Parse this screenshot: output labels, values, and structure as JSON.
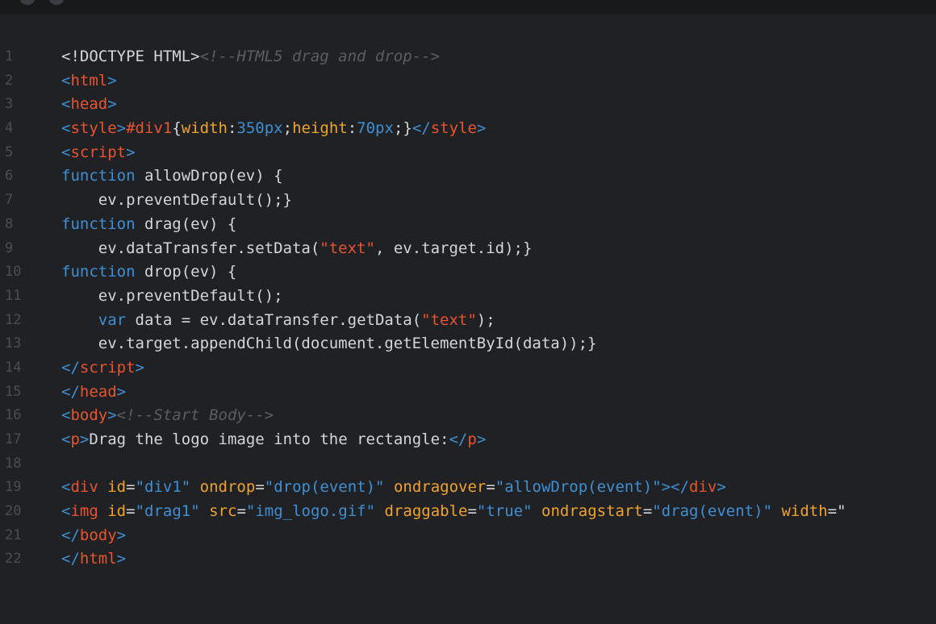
{
  "window": {
    "controls": [
      "close",
      "minimize"
    ]
  },
  "editor": {
    "line_numbers": [
      "1",
      "2",
      "3",
      "4",
      "5",
      "6",
      "7",
      "8",
      "9",
      "10",
      "11",
      "12",
      "13",
      "14",
      "15",
      "16",
      "17",
      "18",
      "19",
      "20",
      "21",
      "22"
    ],
    "lines": [
      [
        {
          "t": "<!DOCTYPE HTML>",
          "c": "plain"
        },
        {
          "t": "<!--HTML5 drag and drop-->",
          "c": "comment"
        }
      ],
      [
        {
          "t": "<",
          "c": "tag"
        },
        {
          "t": "html",
          "c": "tagname"
        },
        {
          "t": ">",
          "c": "tag"
        }
      ],
      [
        {
          "t": "<",
          "c": "tag"
        },
        {
          "t": "head",
          "c": "tagname"
        },
        {
          "t": ">",
          "c": "tag"
        }
      ],
      [
        {
          "t": "<",
          "c": "tag"
        },
        {
          "t": "style",
          "c": "tagname"
        },
        {
          "t": ">",
          "c": "tag"
        },
        {
          "t": "#div1",
          "c": "selector"
        },
        {
          "t": "{",
          "c": "punct"
        },
        {
          "t": "width",
          "c": "attr"
        },
        {
          "t": ":",
          "c": "punct"
        },
        {
          "t": "350px",
          "c": "num"
        },
        {
          "t": ";",
          "c": "punct"
        },
        {
          "t": "height",
          "c": "attr"
        },
        {
          "t": ":",
          "c": "punct"
        },
        {
          "t": "70px",
          "c": "num"
        },
        {
          "t": ";}",
          "c": "punct"
        },
        {
          "t": "</",
          "c": "tag"
        },
        {
          "t": "style",
          "c": "tagname"
        },
        {
          "t": ">",
          "c": "tag"
        }
      ],
      [
        {
          "t": "<",
          "c": "tag"
        },
        {
          "t": "script",
          "c": "tagname"
        },
        {
          "t": ">",
          "c": "tag"
        }
      ],
      [
        {
          "t": "function",
          "c": "kw"
        },
        {
          "t": " allowDrop(ev) {",
          "c": "plain"
        }
      ],
      [
        {
          "t": "    ev.preventDefault();}",
          "c": "plain"
        }
      ],
      [
        {
          "t": "function",
          "c": "kw"
        },
        {
          "t": " drag(ev) {",
          "c": "plain"
        }
      ],
      [
        {
          "t": "    ev.dataTransfer.setData(",
          "c": "plain"
        },
        {
          "t": "\"text\"",
          "c": "jsstr"
        },
        {
          "t": ", ev.target.id);}",
          "c": "plain"
        }
      ],
      [
        {
          "t": "function",
          "c": "kw"
        },
        {
          "t": " drop(ev) {",
          "c": "plain"
        }
      ],
      [
        {
          "t": "    ev.preventDefault();",
          "c": "plain"
        }
      ],
      [
        {
          "t": "    ",
          "c": "plain"
        },
        {
          "t": "var",
          "c": "kw"
        },
        {
          "t": " data = ev.dataTransfer.getData(",
          "c": "plain"
        },
        {
          "t": "\"text\"",
          "c": "jsstr"
        },
        {
          "t": ");",
          "c": "plain"
        }
      ],
      [
        {
          "t": "    ev.target.appendChild(document.getElementById(data));}",
          "c": "plain"
        }
      ],
      [
        {
          "t": "</",
          "c": "tag"
        },
        {
          "t": "script",
          "c": "tagname"
        },
        {
          "t": ">",
          "c": "tag"
        }
      ],
      [
        {
          "t": "</",
          "c": "tag"
        },
        {
          "t": "head",
          "c": "tagname"
        },
        {
          "t": ">",
          "c": "tag"
        }
      ],
      [
        {
          "t": "<",
          "c": "tag"
        },
        {
          "t": "body",
          "c": "tagname"
        },
        {
          "t": ">",
          "c": "tag"
        },
        {
          "t": "<!--Start Body-->",
          "c": "comment"
        }
      ],
      [
        {
          "t": "<",
          "c": "tag"
        },
        {
          "t": "p",
          "c": "tagname"
        },
        {
          "t": ">",
          "c": "tag"
        },
        {
          "t": "Drag the logo image into the rectangle:",
          "c": "plain"
        },
        {
          "t": "</",
          "c": "tag"
        },
        {
          "t": "p",
          "c": "tagname"
        },
        {
          "t": ">",
          "c": "tag"
        }
      ],
      [],
      [
        {
          "t": "<",
          "c": "tag"
        },
        {
          "t": "div",
          "c": "tagname"
        },
        {
          "t": " ",
          "c": "plain"
        },
        {
          "t": "id",
          "c": "attr"
        },
        {
          "t": "=",
          "c": "punct"
        },
        {
          "t": "\"div1\"",
          "c": "str"
        },
        {
          "t": " ",
          "c": "plain"
        },
        {
          "t": "ondrop",
          "c": "attr"
        },
        {
          "t": "=",
          "c": "punct"
        },
        {
          "t": "\"drop(event)\"",
          "c": "str"
        },
        {
          "t": " ",
          "c": "plain"
        },
        {
          "t": "ondragover",
          "c": "attr"
        },
        {
          "t": "=",
          "c": "punct"
        },
        {
          "t": "\"allowDrop(event)\"",
          "c": "str"
        },
        {
          "t": "></",
          "c": "tag"
        },
        {
          "t": "div",
          "c": "tagname"
        },
        {
          "t": ">",
          "c": "tag"
        }
      ],
      [
        {
          "t": "<",
          "c": "tag"
        },
        {
          "t": "img",
          "c": "tagname"
        },
        {
          "t": " ",
          "c": "plain"
        },
        {
          "t": "id",
          "c": "attr"
        },
        {
          "t": "=",
          "c": "punct"
        },
        {
          "t": "\"drag1\"",
          "c": "str"
        },
        {
          "t": " ",
          "c": "plain"
        },
        {
          "t": "src",
          "c": "attr"
        },
        {
          "t": "=",
          "c": "punct"
        },
        {
          "t": "\"img_logo.gif\"",
          "c": "str"
        },
        {
          "t": " ",
          "c": "plain"
        },
        {
          "t": "draggable",
          "c": "attr"
        },
        {
          "t": "=",
          "c": "punct"
        },
        {
          "t": "\"true\"",
          "c": "str"
        },
        {
          "t": " ",
          "c": "plain"
        },
        {
          "t": "ondragstart",
          "c": "attr"
        },
        {
          "t": "=",
          "c": "punct"
        },
        {
          "t": "\"drag(event)\"",
          "c": "str"
        },
        {
          "t": " ",
          "c": "plain"
        },
        {
          "t": "width",
          "c": "attr"
        },
        {
          "t": "=\"",
          "c": "punct"
        }
      ],
      [
        {
          "t": "</",
          "c": "tag"
        },
        {
          "t": "body",
          "c": "tagname"
        },
        {
          "t": ">",
          "c": "tag"
        }
      ],
      [
        {
          "t": "</",
          "c": "tag"
        },
        {
          "t": "html",
          "c": "tagname"
        },
        {
          "t": ">",
          "c": "tag"
        }
      ]
    ]
  }
}
